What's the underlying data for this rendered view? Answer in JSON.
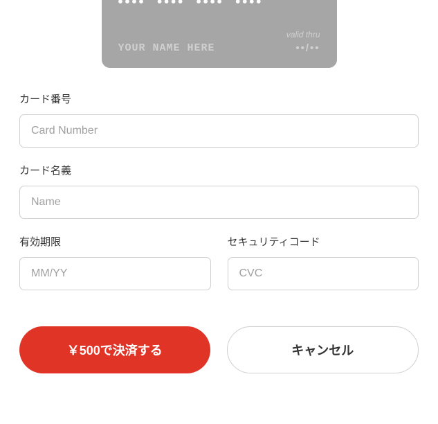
{
  "card": {
    "dots_group": "••••",
    "name_placeholder": "YOUR NAME HERE",
    "valid_label": "valid thru",
    "valid_placeholder": "••/••"
  },
  "form": {
    "card_number": {
      "label": "カード番号",
      "placeholder": "Card Number",
      "value": ""
    },
    "card_name": {
      "label": "カード名義",
      "placeholder": "Name",
      "value": ""
    },
    "expiry": {
      "label": "有効期限",
      "placeholder": "MM/YY",
      "value": ""
    },
    "cvc": {
      "label": "セキュリティコード",
      "placeholder": "CVC",
      "value": ""
    }
  },
  "buttons": {
    "submit": "￥500で決済する",
    "cancel": "キャンセル"
  }
}
